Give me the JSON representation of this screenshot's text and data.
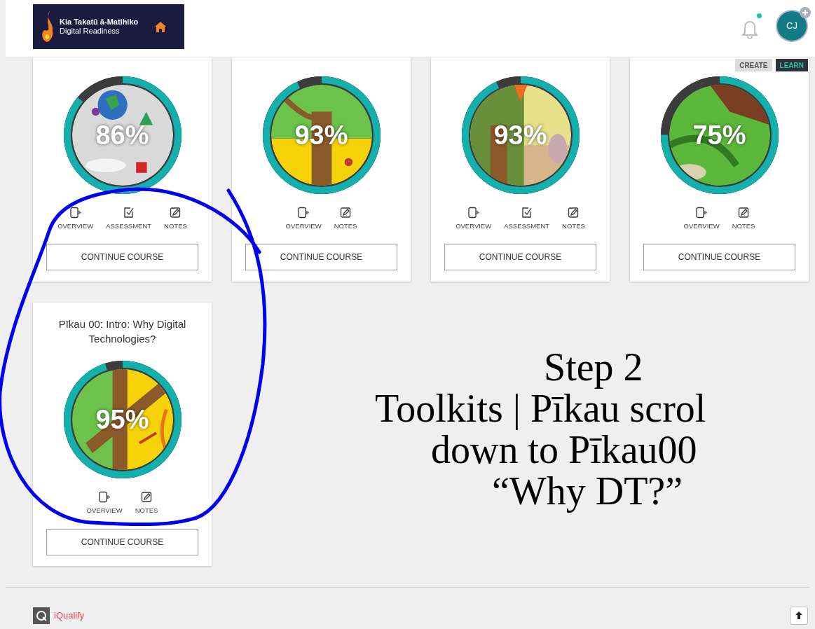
{
  "header": {
    "brand_title": "Kia Takatū ā-Matihiko",
    "brand_subtitle": "Digital Readiness",
    "notifications_unread": true,
    "avatar_initials": "CJ"
  },
  "mode_toggle": [
    {
      "label": "CREATE",
      "selected": false
    },
    {
      "label": "LEARN",
      "selected": true
    }
  ],
  "courses": [
    {
      "percent": "86%",
      "level": 0.86,
      "actions": [
        {
          "kind": "overview",
          "label": "OVERVIEW"
        },
        {
          "kind": "assessment",
          "label": "ASSESSMENT"
        },
        {
          "kind": "notes",
          "label": "NOTES"
        }
      ],
      "button": "CONTINUE COURSE"
    },
    {
      "percent": "93%",
      "level": 0.93,
      "actions": [
        {
          "kind": "overview",
          "label": "OVERVIEW"
        },
        {
          "kind": "notes",
          "label": "NOTES"
        }
      ],
      "button": "CONTINUE COURSE"
    },
    {
      "percent": "93%",
      "level": 0.93,
      "actions": [
        {
          "kind": "overview",
          "label": "OVERVIEW"
        },
        {
          "kind": "assessment",
          "label": "ASSESSMENT"
        },
        {
          "kind": "notes",
          "label": "NOTES"
        }
      ],
      "button": "CONTINUE COURSE"
    },
    {
      "percent": "75%",
      "level": 0.75,
      "actions": [
        {
          "kind": "overview",
          "label": "OVERVIEW"
        },
        {
          "kind": "notes",
          "label": "NOTES"
        }
      ],
      "button": "CONTINUE COURSE"
    },
    {
      "title": "Pīkau 00: Intro: Why Digital Technologies?",
      "percent": "95%",
      "level": 0.95,
      "actions": [
        {
          "kind": "overview",
          "label": "OVERVIEW"
        },
        {
          "kind": "notes",
          "label": "NOTES"
        }
      ],
      "button": "CONTINUE COURSE"
    }
  ],
  "annotation": [
    "Step 2",
    "Toolkits | Pīkau scrol",
    "down to Pīkau00",
    "“Why DT?”"
  ],
  "footer": {
    "brand": "iQualify"
  }
}
